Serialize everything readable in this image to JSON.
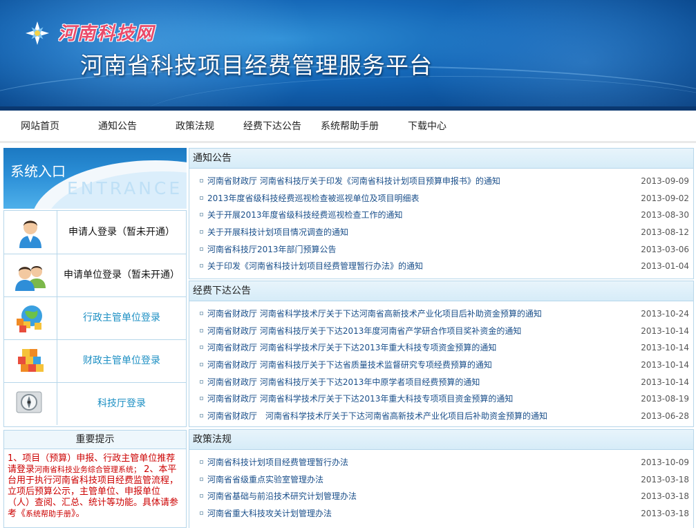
{
  "header": {
    "logo_text": "河南科技网",
    "site_title": "河南省科技项目经费管理服务平台"
  },
  "nav": [
    {
      "label": "网站首页"
    },
    {
      "label": "通知公告"
    },
    {
      "label": "政策法规"
    },
    {
      "label": "经费下达公告"
    },
    {
      "label": "系统帮助手册"
    },
    {
      "label": "下载中心"
    }
  ],
  "entrance": {
    "title": "系统入口",
    "subtitle": "ENTRANCE"
  },
  "logins": [
    {
      "label": "申请人登录（暂未开通）",
      "icon": "user-icon"
    },
    {
      "label": "申请单位登录（暂未开通）",
      "icon": "users-icon"
    },
    {
      "label": "行政主管单位登录",
      "icon": "globe-blocks-icon"
    },
    {
      "label": "财政主管单位登录",
      "icon": "blocks-icon"
    },
    {
      "label": "科技厅登录",
      "icon": "compass-icon"
    }
  ],
  "notice": {
    "title": "重要提示",
    "line1": "1、项目（预算）申报、行政主管单位推荐请登录",
    "line1_small": "河南省科技业务综合管理系统；",
    "line2": " 2、本平台用于执行河南省科技项目经费监管流程，立项后预算公示，主管单位、申报单位（人）查阅、汇总、统计等功能。具体请参考《",
    "line2_small": "系统帮助手册",
    "line2_end": "》。"
  },
  "panels": [
    {
      "title": "通知公告",
      "items": [
        {
          "text": "河南省财政厅 河南省科技厅关于印发《河南省科技计划项目预算申报书》的通知",
          "date": "2013-09-09"
        },
        {
          "text": "2013年度省级科技经费巡视检查被巡视单位及项目明细表",
          "date": "2013-09-02"
        },
        {
          "text": "关于开展2013年度省级科技经费巡视检查工作的通知",
          "date": "2013-08-30"
        },
        {
          "text": "关于开展科技计划项目情况调查的通知",
          "date": "2013-08-12"
        },
        {
          "text": "河南省科技厅2013年部门预算公告",
          "date": "2013-03-06"
        },
        {
          "text": "关于印发《河南省科技计划项目经费管理暂行办法》的通知",
          "date": "2013-01-04"
        }
      ]
    },
    {
      "title": "经费下达公告",
      "items": [
        {
          "text": "河南省财政厅 河南省科学技术厅关于下达河南省高新技术产业化项目后补助资金预算的通知",
          "date": "2013-10-24"
        },
        {
          "text": "河南省财政厅 河南省科技厅关于下达2013年度河南省产学研合作项目奖补资金的通知",
          "date": "2013-10-14"
        },
        {
          "text": "河南省财政厅 河南省科学技术厅关于下达2013年重大科技专项资金预算的通知",
          "date": "2013-10-14"
        },
        {
          "text": "河南省财政厅 河南省科技厅关于下达省质量技术监督研究专项经费预算的通知",
          "date": "2013-10-14"
        },
        {
          "text": "河南省财政厅 河南省科技厅关于下达2013年中原学者项目经费预算的通知",
          "date": "2013-10-14"
        },
        {
          "text": "河南省财政厅 河南省科学技术厅关于下达2013年重大科技专项项目资金预算的通知",
          "date": "2013-08-19"
        },
        {
          "text": "河南省财政厅　河南省科学技术厅关于下达河南省高新技术产业化项目后补助资金预算的通知",
          "date": "2013-06-28"
        }
      ]
    },
    {
      "title": "政策法规",
      "items": [
        {
          "text": "河南省科技计划项目经费管理暂行办法",
          "date": "2013-10-09"
        },
        {
          "text": "河南省省级重点实验室管理办法",
          "date": "2013-03-18"
        },
        {
          "text": "河南省基础与前沿技术研究计划管理办法",
          "date": "2013-03-18"
        },
        {
          "text": "河南省重大科技攻关计划管理办法",
          "date": "2013-03-18"
        }
      ]
    }
  ]
}
